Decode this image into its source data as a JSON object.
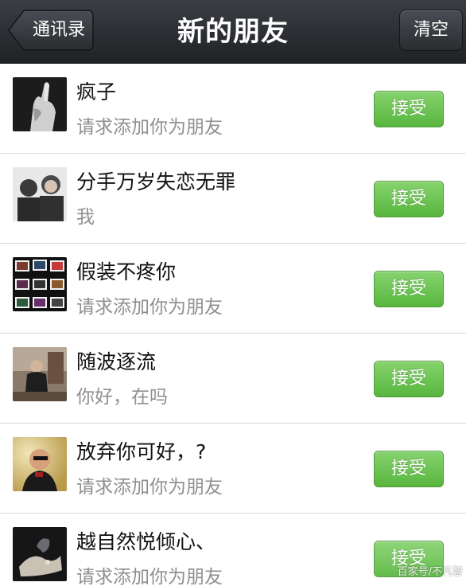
{
  "header": {
    "title": "新的朋友",
    "back_label": "通讯录",
    "clear_label": "清空"
  },
  "requests": [
    {
      "name": "疯子",
      "message": "请求添加你为朋友",
      "accept_label": "接受"
    },
    {
      "name": "分手万岁失恋无罪",
      "message": "我",
      "accept_label": "接受"
    },
    {
      "name": "假装不疼你",
      "message": "请求添加你为朋友",
      "accept_label": "接受"
    },
    {
      "name": "随波逐流",
      "message": "你好，在吗",
      "accept_label": "接受"
    },
    {
      "name": "放弃你可好，?",
      "message": "请求添加你为朋友",
      "accept_label": "接受"
    },
    {
      "name": "越自然悦倾心、",
      "message": "请求添加你为朋友",
      "accept_label": "接受"
    }
  ],
  "watermark": "百家号/不凡智",
  "colors": {
    "navbar": "#2b2d31",
    "accept_green": "#6cc552",
    "secondary_text": "#8f8f8f"
  }
}
